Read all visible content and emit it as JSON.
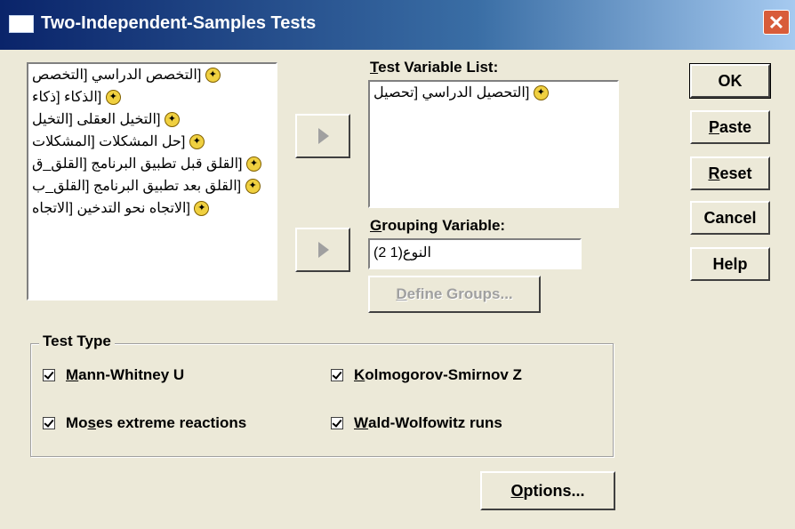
{
  "window": {
    "title": "Two-Independent-Samples Tests",
    "close": "✕"
  },
  "source_list": {
    "items": [
      "[التخصص الدراسي [التخصص",
      "[الذكاء [ذكاء",
      "[التخيل العقلى [التخيل",
      "[حل المشكلات [المشكلات",
      "[القلق قبل تطبيق البرنامج [القلق_ق",
      "[القلق بعد تطبيق البرنامج [القلق_ب",
      "[الاتجاه نحو التدخين [الاتجاه"
    ]
  },
  "test_variable": {
    "label_underline": "T",
    "label_rest": "est Variable List:",
    "items": [
      "[التحصيل الدراسي [تحصيل"
    ]
  },
  "grouping": {
    "label_underline": "G",
    "label_rest": "rouping Variable:",
    "value": "النوع(1 2)"
  },
  "define_groups": {
    "label_underline": "D",
    "label_rest": "efine Groups..."
  },
  "buttons": {
    "ok": "OK",
    "paste_u": "P",
    "paste_rest": "aste",
    "reset_u": "R",
    "reset_rest": "eset",
    "cancel": "Cancel",
    "help": "Help",
    "options_u": "O",
    "options_rest": "ptions..."
  },
  "test_type": {
    "title": "Test Type",
    "mann_u": "M",
    "mann_rest": "ann-Whitney U",
    "kolmo_u": "K",
    "kolmo_rest": "olmogorov-Smirnov Z",
    "moses_pre": "Mo",
    "moses_u": "s",
    "moses_rest": "es extreme reactions",
    "wald_u": "W",
    "wald_rest": "ald-Wolfowitz runs",
    "checked": [
      true,
      true,
      true,
      true
    ]
  },
  "icons": {
    "variable": "variable-ruler-icon",
    "arrow": "right-arrow-icon"
  }
}
